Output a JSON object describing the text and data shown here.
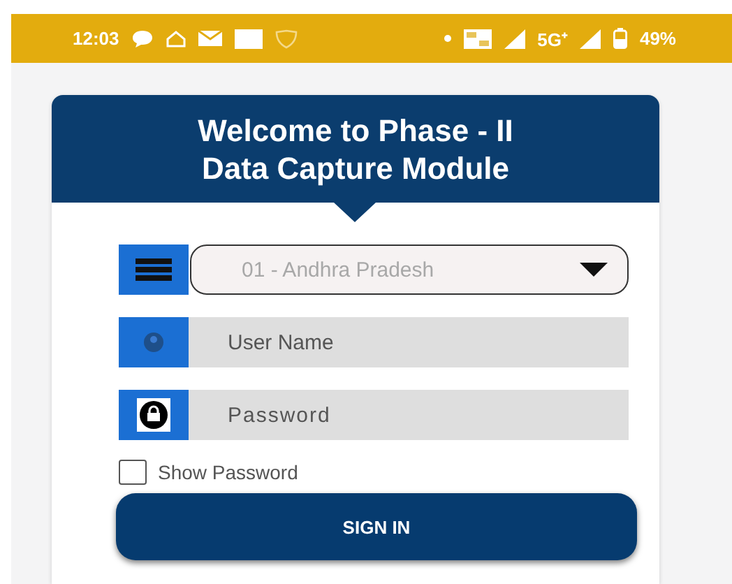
{
  "status_bar": {
    "time": "12:03",
    "network": "5G⁺",
    "battery": "49%"
  },
  "header": {
    "title_lines": [
      "Welcome to Phase - II",
      "Data Capture Module"
    ]
  },
  "state_select": {
    "value": "01 - Andhra Pradesh"
  },
  "username": {
    "placeholder": "User Name"
  },
  "password": {
    "placeholder": "Password"
  },
  "show_password": {
    "label": "Show Password",
    "checked": false
  },
  "sign_in": {
    "label": "SIGN IN"
  }
}
